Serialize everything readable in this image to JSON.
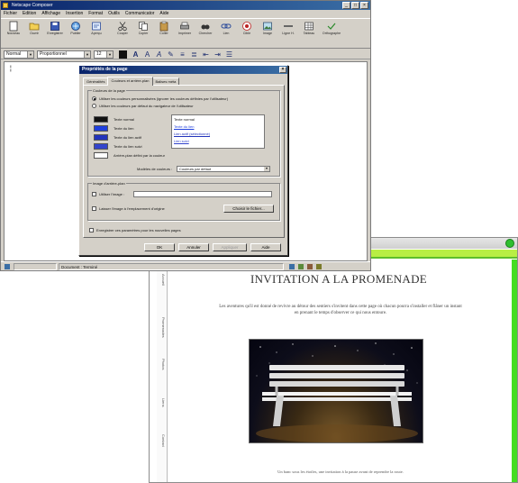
{
  "front_window": {
    "title": "Netscape Composer",
    "menu": [
      "Fichier",
      "Edition",
      "Affichage",
      "Insertion",
      "Format",
      "Outils",
      "Communicator",
      "Aide"
    ],
    "toolbar": [
      "Nouveau",
      "Ouvrir",
      "Enregistrer",
      "Publier",
      "Aperçu",
      "Couper",
      "Copier",
      "Coller",
      "Imprimer",
      "Chercher",
      "Lien",
      "Cible",
      "Image",
      "Ligne H.",
      "Tableau",
      "Orthographe"
    ],
    "font_select": "Normal",
    "font_face": "Proportionnel",
    "font_size": "12",
    "status_text": "Document : Terminé"
  },
  "dialog": {
    "title": "Propriétés de la page",
    "close": "×",
    "tabs": [
      "Généralités",
      "Couleurs et arrière-plan",
      "Balises méta"
    ],
    "group_colors_legend": "Couleurs de la page",
    "radio_custom": "Utiliser les couleurs personnalisées (ignorer les couleurs définies par l'utilisateur)",
    "radio_default": "Utiliser les couleurs par défaut du navigateur de l'utilisateur",
    "swatches": [
      {
        "label": "Texte normal",
        "color": "#111111"
      },
      {
        "label": "Texte du lien",
        "color": "#1f3fdd"
      },
      {
        "label": "Texte du lien actif",
        "color": "#2233bb"
      },
      {
        "label": "Texte du lien suivi",
        "color": "#3344cc"
      },
      {
        "label": "Arrière-plan",
        "color": "#ffffff"
      }
    ],
    "preview_lines": [
      "Texte normal",
      "Texte du lien",
      "Lien actif (sélectionné)",
      "Lien suivi"
    ],
    "custom_bg_label": "Arrière-plan défini par la couleur",
    "scheme_label": "Modèles de couleurs :",
    "scheme_value": "Couleurs par défaut",
    "group_bg_legend": "Image d'arrière-plan",
    "use_image_label": "Utiliser l'image :",
    "keep_image_label": "Laisser l'image à l'emplacement d'origine",
    "choose_file": "Choisir le fichier...",
    "save_default_label": "Enregistrer ces paramètres pour les nouvelles pages",
    "buttons": {
      "ok": "OK",
      "cancel": "Annuler",
      "apply": "Appliquer",
      "help": "Aide"
    }
  },
  "back_window": {
    "sidebar_links": [
      "Accueil",
      "Promenades",
      "Photos",
      "Liens",
      "Contact"
    ],
    "page_title": "INVITATION A LA PROMENADE",
    "paragraph_lines": [
      "Les aventures qu'il est donné de revivre au détour des sentiers s'invitent dans cette page où chacun pourra s'installer et flâner un instant",
      "en prenant le temps d'observer ce qui nous entoure."
    ],
    "caption": "Un banc sous les étoiles, une invitation à la pause avant de reprendre la route."
  }
}
